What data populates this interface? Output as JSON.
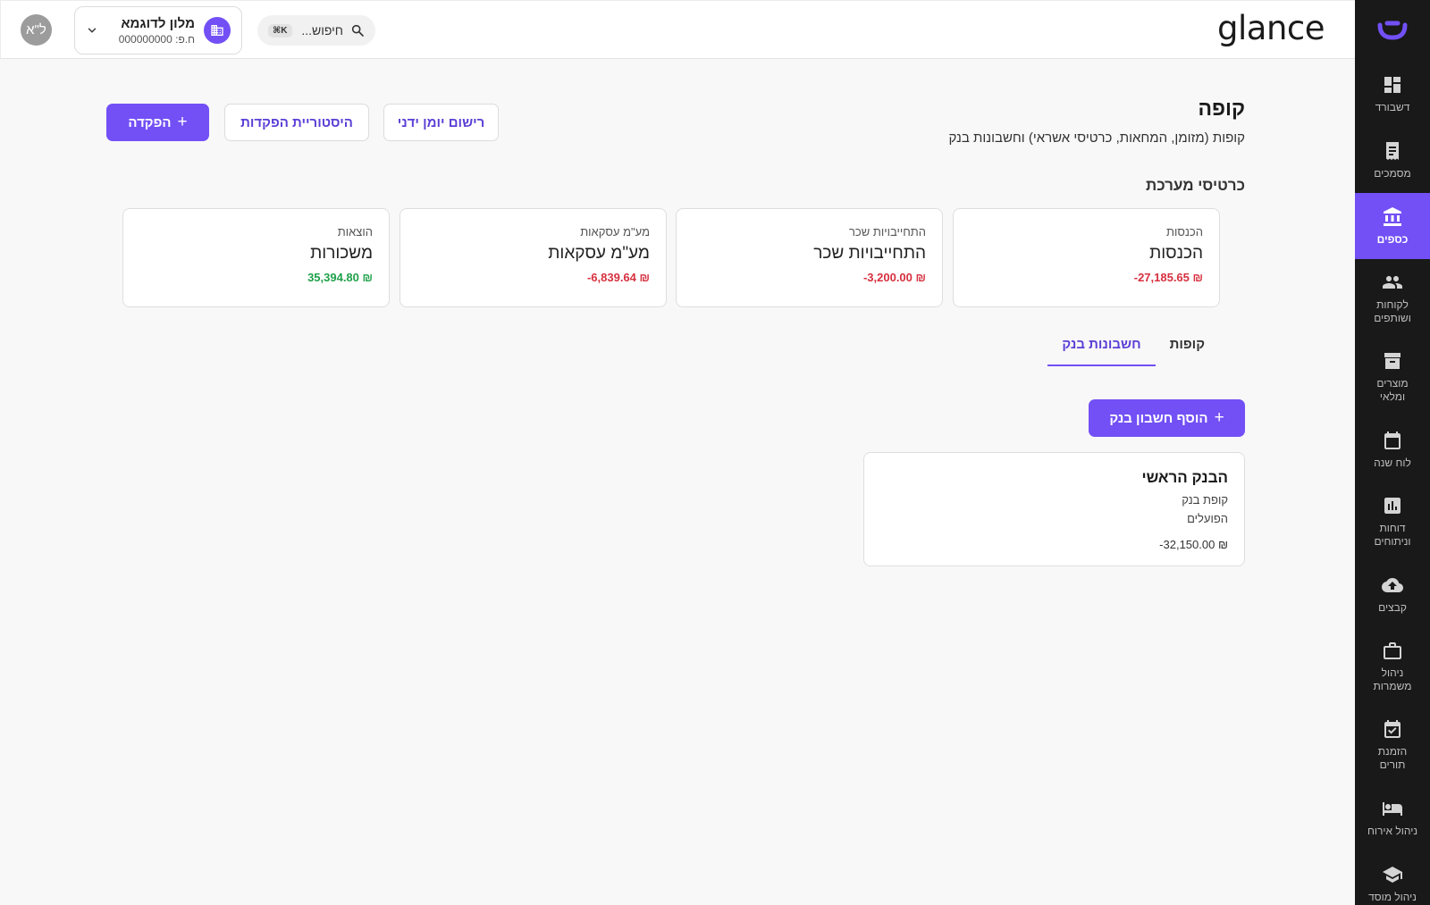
{
  "app": {
    "brand": "glance"
  },
  "header": {
    "search_placeholder": "חיפוש...",
    "search_shortcut": "K⌘",
    "business_name": "מלון לדוגמא",
    "business_id": "ח.פ: 000000000",
    "user_initials": "ל\"א"
  },
  "sidebar": {
    "items": [
      {
        "label": "דשבורד",
        "icon": "dashboard-icon"
      },
      {
        "label": "מסמכים",
        "icon": "document-icon"
      },
      {
        "label": "כספים",
        "icon": "bank-icon",
        "active": true
      },
      {
        "label": "לקוחות\nושותפים",
        "icon": "people-icon"
      },
      {
        "label": "מוצרים\nומלאי",
        "icon": "archive-icon"
      },
      {
        "label": "לוח שנה",
        "icon": "calendar-icon"
      },
      {
        "label": "דוחות\nוניתוחים",
        "icon": "chart-icon"
      },
      {
        "label": "קבצים",
        "icon": "cloud-upload-icon"
      },
      {
        "label": "ניהול\nמשמרות",
        "icon": "briefcase-icon"
      },
      {
        "label": "הזמנת\nתורים",
        "icon": "calendar-check-icon"
      },
      {
        "label": "ניהול אירוח",
        "icon": "bed-icon"
      },
      {
        "label": "ניהול מוסד",
        "icon": "school-icon"
      }
    ]
  },
  "page": {
    "title": "קופה",
    "subtitle": "קופות (מזומן, המחאות, כרטיסי אשראי) וחשבונות בנק",
    "buttons": {
      "manual_journal": "רישום יומן ידני",
      "deposit_history": "היסטוריית הפקדות",
      "deposit": "הפקדה"
    },
    "system_cards_title": "כרטיסי מערכת",
    "system_cards": [
      {
        "label": "הכנסות",
        "title": "הכנסות",
        "amount": "-27,185.65 ₪",
        "status": "negative"
      },
      {
        "label": "התחייבויות שכר",
        "title": "התחייבויות שכר",
        "amount": "-3,200.00 ₪",
        "status": "negative"
      },
      {
        "label": "מע\"מ עסקאות",
        "title": "מע\"מ עסקאות",
        "amount": "-6,839.64 ₪",
        "status": "negative"
      },
      {
        "label": "הוצאות",
        "title": "משכורות",
        "amount": "35,394.80 ₪",
        "status": "positive"
      }
    ],
    "tabs": [
      {
        "label": "קופות",
        "active": false
      },
      {
        "label": "חשבונות בנק",
        "active": true
      }
    ],
    "add_bank_button": "הוסף חשבון בנק",
    "bank_accounts": [
      {
        "name": "הבנק הראשי",
        "type": "קופת בנק",
        "bank": "הפועלים",
        "balance": "-32,150.00 ₪"
      }
    ]
  },
  "colors": {
    "accent": "#7250f5",
    "sidebar_bg": "#191919",
    "negative": "#d6303f",
    "positive": "#1fa14a"
  }
}
